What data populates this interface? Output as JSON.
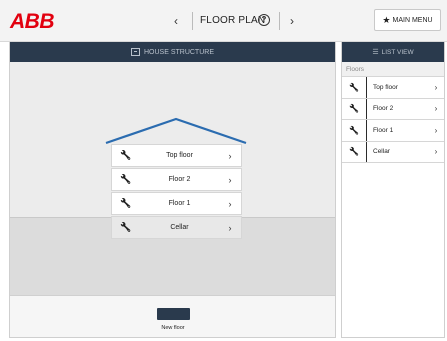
{
  "header": {
    "logo": "ABB",
    "prev": "‹",
    "title": "FLOOR PLAN",
    "help": "?",
    "next": "›",
    "main_menu": "MAIN MENU",
    "star": "★"
  },
  "left_panel": {
    "title": "HOUSE STRUCTURE",
    "floors": [
      {
        "label": "Top floor",
        "selected": false
      },
      {
        "label": "Floor 2",
        "selected": false
      },
      {
        "label": "Floor 1",
        "selected": false
      },
      {
        "label": "Cellar",
        "selected": true
      }
    ],
    "new_floor": "New floor"
  },
  "right_panel": {
    "title": "LIST VIEW",
    "section": "Floors",
    "items": [
      "Top floor",
      "Floor 2",
      "Floor 1",
      "Cellar"
    ]
  },
  "icons": {
    "wrench": "🔧",
    "chevron": "›"
  },
  "colors": {
    "brand": "#e2000f",
    "header_dark": "#2a3a4d",
    "roof": "#2b6cb0"
  }
}
